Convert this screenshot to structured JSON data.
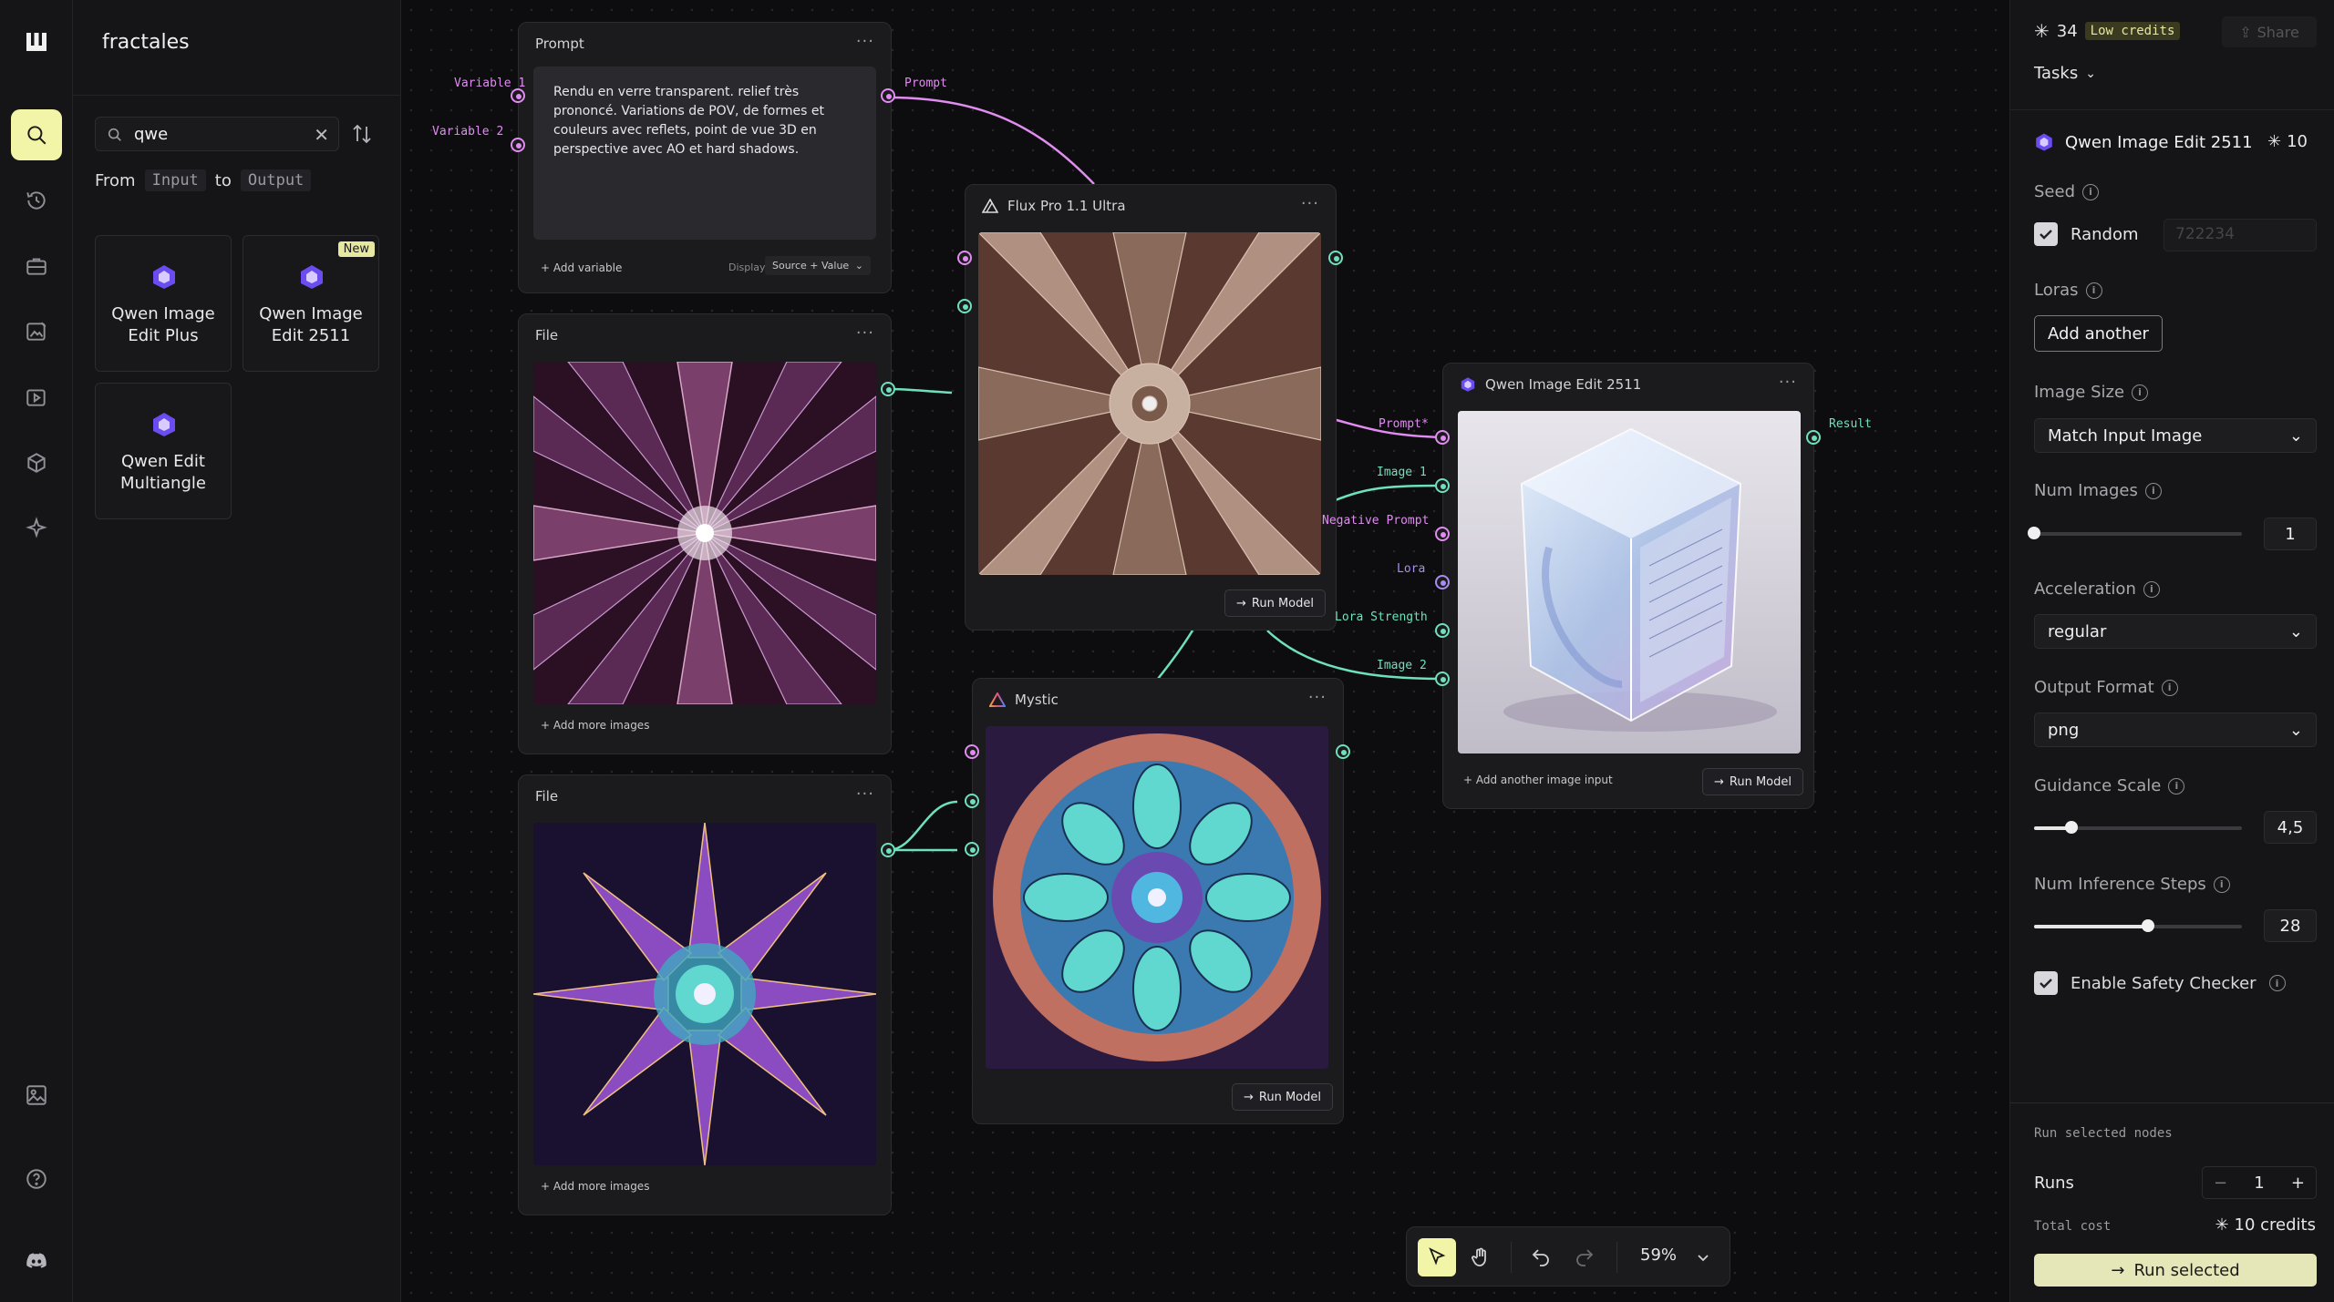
{
  "sidebar": {
    "project_title": "fractales",
    "search": {
      "value": "qwe"
    },
    "from_label": "From",
    "from_chip": "Input",
    "to_label": "to",
    "to_chip": "Output",
    "models": [
      {
        "label_line1": "Qwen Image",
        "label_line2": "Edit Plus",
        "badge": ""
      },
      {
        "label_line1": "Qwen Image",
        "label_line2": "Edit 2511",
        "badge": "New"
      },
      {
        "label_line1": "Qwen Edit",
        "label_line2": "Multiangle",
        "badge": ""
      }
    ]
  },
  "nodes": {
    "prompt": {
      "title": "Prompt",
      "text": "Rendu en verre transparent. relief très prononcé. Variations de  POV, de formes et couleurs avec reflets, point de vue 3D en perspective avec AO et hard shadows.",
      "add_variable": "Add variable",
      "display_label": "Display",
      "display_value": "Source + Value",
      "variable1": "Variable 1",
      "variable2": "Variable 2",
      "output_label": "Prompt"
    },
    "file1": {
      "title": "File",
      "add_more": "+ Add more images"
    },
    "file2": {
      "title": "File",
      "add_more": "+ Add more images"
    },
    "flux": {
      "title": "Flux Pro 1.1 Ultra",
      "run": "Run Model"
    },
    "mystic": {
      "title": "Mystic",
      "run": "Run Model"
    },
    "qwen": {
      "title": "Qwen Image Edit 2511",
      "run": "Run Model",
      "add_input": "Add another image input",
      "inputs": [
        "Prompt*",
        "Image 1",
        "Negative Prompt",
        "Lora",
        "Lora Strength",
        "Image 2"
      ],
      "output_label": "Result"
    }
  },
  "toolbar": {
    "zoom": "59%"
  },
  "rpanel": {
    "credits": "34",
    "low_credits": "Low credits",
    "share": "Share",
    "tasks": "Tasks",
    "model_title": "Qwen Image Edit 2511",
    "model_cost": "10",
    "seed_label": "Seed",
    "random_label": "Random",
    "seed_value": "722234",
    "loras_label": "Loras",
    "add_another": "Add another",
    "image_size_label": "Image Size",
    "image_size_value": "Match Input Image",
    "num_images_label": "Num Images",
    "num_images_value": "1",
    "num_images_fraction": 0.0,
    "acceleration_label": "Acceleration",
    "acceleration_value": "regular",
    "output_format_label": "Output Format",
    "output_format_value": "png",
    "guidance_label": "Guidance Scale",
    "guidance_value": "4,5",
    "guidance_fraction": 0.18,
    "steps_label": "Num Inference Steps",
    "steps_value": "28",
    "steps_fraction": 0.55,
    "safety_label": "Enable Safety Checker",
    "run_selected_nodes": "Run selected nodes",
    "runs_label": "Runs",
    "runs_value": "1",
    "total_cost_label": "Total cost",
    "total_cost_value": "10 credits",
    "run_selected": "Run selected"
  },
  "colors": {
    "accent": "#f2f4a8",
    "port_pink": "#e08cf0",
    "port_green": "#6fe0bd",
    "port_violet": "#a98cf0"
  }
}
